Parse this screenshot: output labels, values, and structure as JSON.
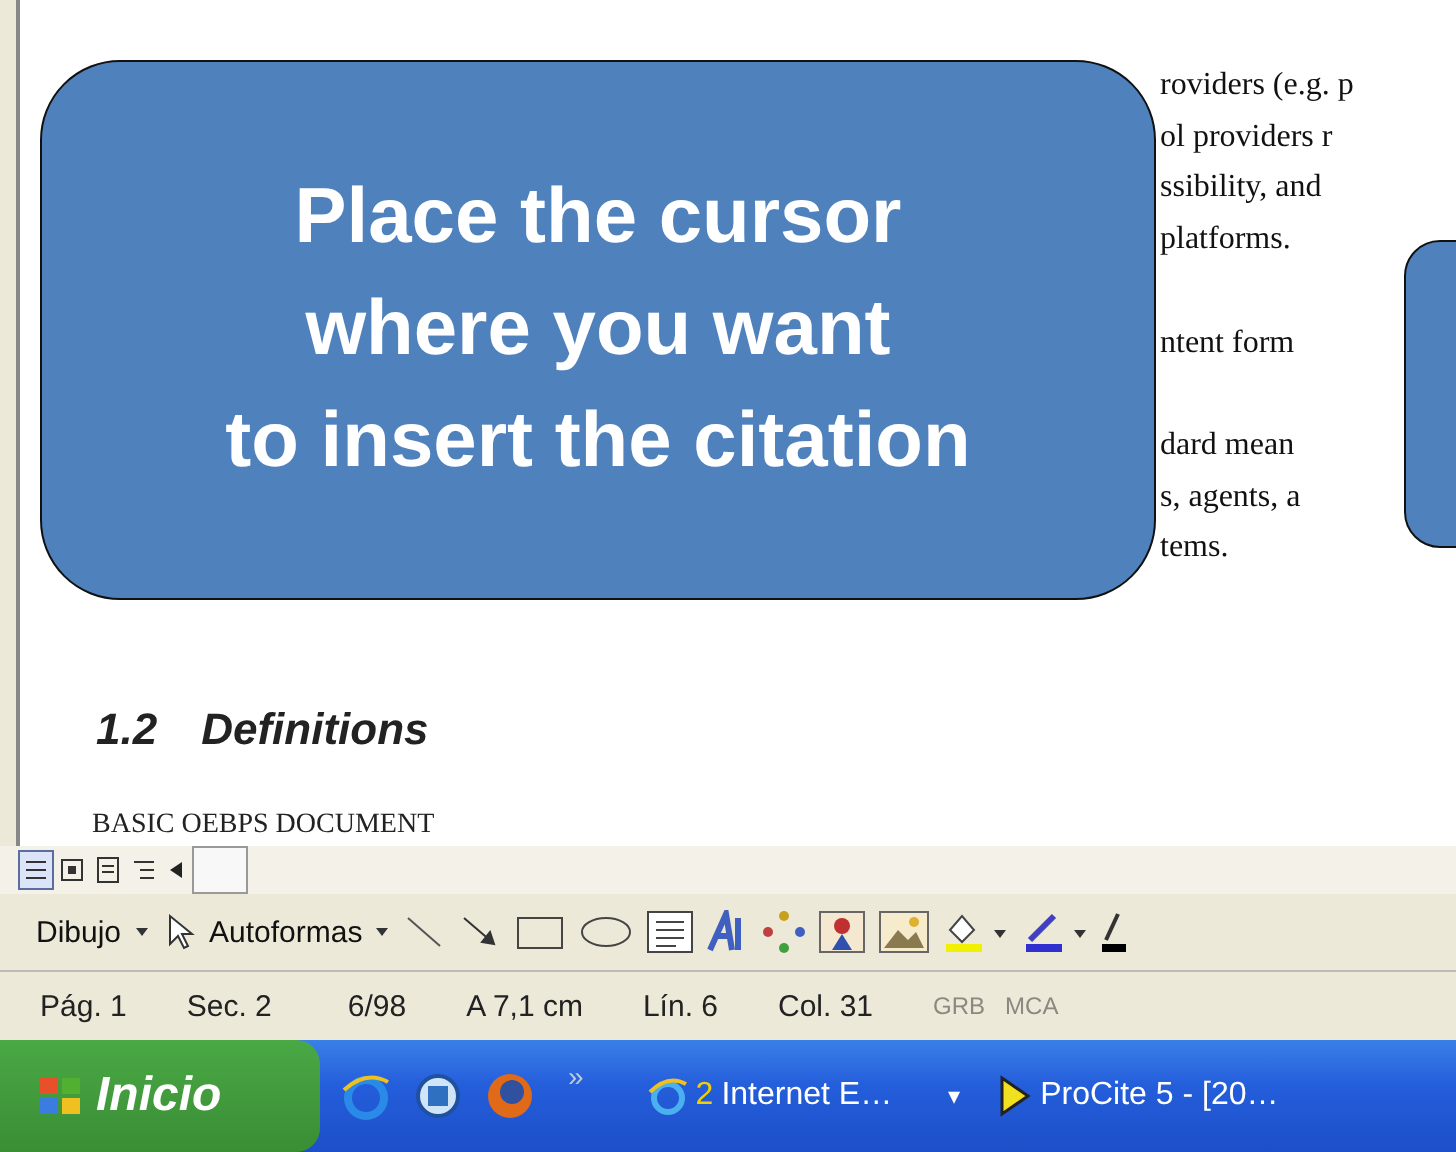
{
  "document": {
    "paragraphs": [
      [
        "roviders (e.g. p",
        "ol providers r",
        "ssibility, and",
        "platforms."
      ],
      [
        "ntent form"
      ],
      [
        "dard mean",
        "s, agents, a",
        "tems."
      ]
    ],
    "heading": {
      "number": "1.2",
      "title": "Definitions"
    },
    "paragraph": "BASIC OEBPS DOCUMENT"
  },
  "callout": {
    "text": "Place the cursor\nwhere you want\nto insert the citation"
  },
  "drawing_toolbar": {
    "menus": [
      "Dibujo",
      "Autoformas"
    ]
  },
  "status_bar": {
    "fields": [
      {
        "text": "Pág. 1",
        "disabled": false
      },
      {
        "text": "Sec. 2",
        "disabled": false
      },
      {
        "text": "6/98",
        "disabled": false
      },
      {
        "text": "A 7,1 cm",
        "disabled": false
      },
      {
        "text": "Lín. 6",
        "disabled": false
      },
      {
        "text": "Col. 31",
        "disabled": false
      },
      {
        "text": "GRB",
        "disabled": true
      },
      {
        "text": "MCA",
        "disabled": true
      }
    ]
  },
  "taskbar": {
    "start": "Inicio",
    "overflow": "»",
    "tasks": [
      {
        "count": "2",
        "label": "Internet E…",
        "menu": "▾"
      },
      {
        "label": "ProCite 5 - [20…"
      }
    ]
  }
}
